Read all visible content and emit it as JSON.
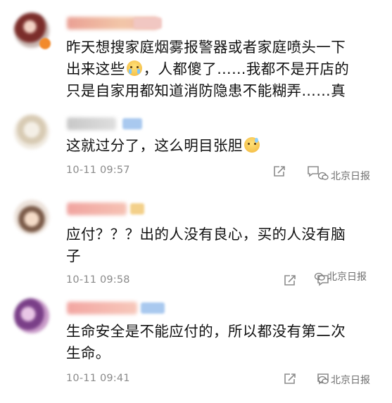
{
  "comments": [
    {
      "text_line1": "昨天想搜家庭烟雾报警器或者家庭喷头一下",
      "text_line2a": "出来这些",
      "emoji1": "crying-face-emoji",
      "text_line2b": "，人都傻了……我都不是开店的",
      "text_line3": "只是自家用都知道消防隐患不能糊弄……真"
    },
    {
      "text_line1": "这就过分了，这么明目张胆",
      "emoji1": "sweat-face-emoji",
      "timestamp": "10-11 09:57",
      "share_icon": "share-icon",
      "comment_icon": "comment-icon",
      "watermark": "北京日报"
    },
    {
      "text_line1": "应付？？？出的人没有良心，买的人没有脑",
      "text_line2": "子",
      "timestamp": "10-11 09:58",
      "share_icon": "share-icon",
      "comment_icon": "comment-icon",
      "watermark": "北京日报"
    },
    {
      "text_line1": "生命安全是不能应付的，所以都没有第二次",
      "text_line2": "生命。",
      "timestamp": "10-11 09:41",
      "share_icon": "share-icon",
      "comment_icon": "comment-icon",
      "watermark": "北京日报"
    }
  ],
  "colors": {
    "text": "#111111",
    "timestamp": "#8a8a8a",
    "icon": "#8c8c8c",
    "username_blur": "#e8a39a",
    "badge_blue": "#a9c9ef"
  }
}
